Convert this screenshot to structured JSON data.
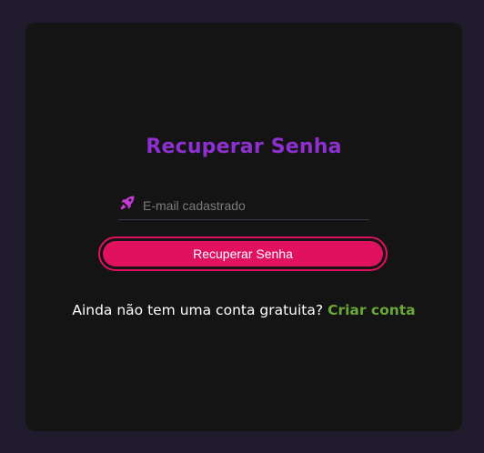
{
  "form": {
    "title": "Recuperar Senha",
    "email_placeholder": "E-mail cadastrado",
    "email_icon": "rocket-icon",
    "submit_label": "Recuperar Senha"
  },
  "signup": {
    "prompt": "Ainda não tem uma conta gratuita?",
    "link_label": "Criar conta"
  },
  "colors": {
    "background": "#201b2c",
    "card": "#141414",
    "title": "#8e2fd0",
    "button": "#e0115f",
    "icon": "#c53bd6",
    "link": "#6aa83b"
  }
}
